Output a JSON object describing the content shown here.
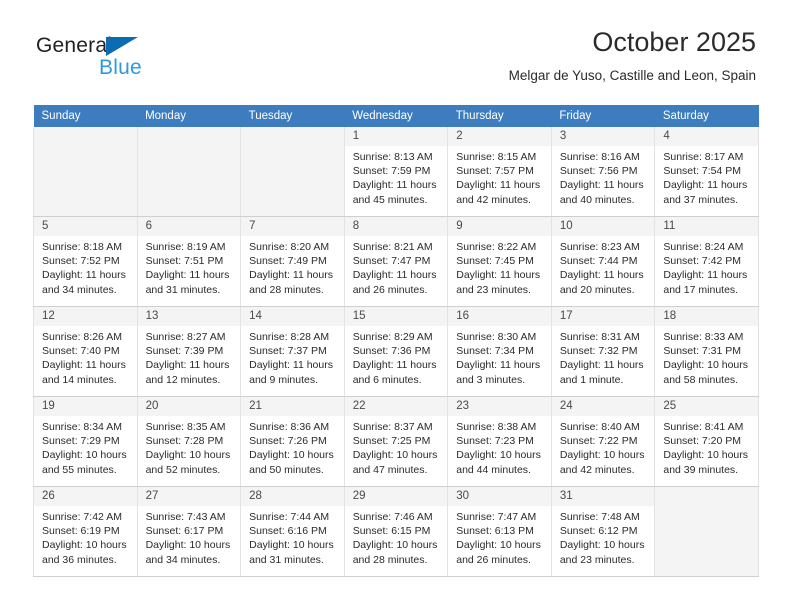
{
  "logo": {
    "word_one": "General",
    "word_two": "Blue",
    "triangle_color": "#0b6cb3",
    "blue_text_color": "#2e9ade"
  },
  "header": {
    "month_title": "October 2025",
    "location": "Melgar de Yuso, Castille and Leon, Spain"
  },
  "theme": {
    "header_row_background": "#3d7dbf",
    "header_row_text": "#ffffff",
    "day_number_background": "#f4f4f4",
    "grid_border": "#cfcfcf",
    "body_text": "#2b2b2b"
  },
  "weekday_headers": [
    "Sunday",
    "Monday",
    "Tuesday",
    "Wednesday",
    "Thursday",
    "Friday",
    "Saturday"
  ],
  "weeks": [
    [
      {
        "day": "",
        "empty": true,
        "sunrise": "",
        "sunset": "",
        "daylight_line1": "",
        "daylight_line2": ""
      },
      {
        "day": "",
        "empty": true,
        "sunrise": "",
        "sunset": "",
        "daylight_line1": "",
        "daylight_line2": ""
      },
      {
        "day": "",
        "empty": true,
        "sunrise": "",
        "sunset": "",
        "daylight_line1": "",
        "daylight_line2": ""
      },
      {
        "day": "1",
        "empty": false,
        "sunrise": "Sunrise: 8:13 AM",
        "sunset": "Sunset: 7:59 PM",
        "daylight_line1": "Daylight: 11 hours",
        "daylight_line2": "and 45 minutes."
      },
      {
        "day": "2",
        "empty": false,
        "sunrise": "Sunrise: 8:15 AM",
        "sunset": "Sunset: 7:57 PM",
        "daylight_line1": "Daylight: 11 hours",
        "daylight_line2": "and 42 minutes."
      },
      {
        "day": "3",
        "empty": false,
        "sunrise": "Sunrise: 8:16 AM",
        "sunset": "Sunset: 7:56 PM",
        "daylight_line1": "Daylight: 11 hours",
        "daylight_line2": "and 40 minutes."
      },
      {
        "day": "4",
        "empty": false,
        "sunrise": "Sunrise: 8:17 AM",
        "sunset": "Sunset: 7:54 PM",
        "daylight_line1": "Daylight: 11 hours",
        "daylight_line2": "and 37 minutes."
      }
    ],
    [
      {
        "day": "5",
        "empty": false,
        "sunrise": "Sunrise: 8:18 AM",
        "sunset": "Sunset: 7:52 PM",
        "daylight_line1": "Daylight: 11 hours",
        "daylight_line2": "and 34 minutes."
      },
      {
        "day": "6",
        "empty": false,
        "sunrise": "Sunrise: 8:19 AM",
        "sunset": "Sunset: 7:51 PM",
        "daylight_line1": "Daylight: 11 hours",
        "daylight_line2": "and 31 minutes."
      },
      {
        "day": "7",
        "empty": false,
        "sunrise": "Sunrise: 8:20 AM",
        "sunset": "Sunset: 7:49 PM",
        "daylight_line1": "Daylight: 11 hours",
        "daylight_line2": "and 28 minutes."
      },
      {
        "day": "8",
        "empty": false,
        "sunrise": "Sunrise: 8:21 AM",
        "sunset": "Sunset: 7:47 PM",
        "daylight_line1": "Daylight: 11 hours",
        "daylight_line2": "and 26 minutes."
      },
      {
        "day": "9",
        "empty": false,
        "sunrise": "Sunrise: 8:22 AM",
        "sunset": "Sunset: 7:45 PM",
        "daylight_line1": "Daylight: 11 hours",
        "daylight_line2": "and 23 minutes."
      },
      {
        "day": "10",
        "empty": false,
        "sunrise": "Sunrise: 8:23 AM",
        "sunset": "Sunset: 7:44 PM",
        "daylight_line1": "Daylight: 11 hours",
        "daylight_line2": "and 20 minutes."
      },
      {
        "day": "11",
        "empty": false,
        "sunrise": "Sunrise: 8:24 AM",
        "sunset": "Sunset: 7:42 PM",
        "daylight_line1": "Daylight: 11 hours",
        "daylight_line2": "and 17 minutes."
      }
    ],
    [
      {
        "day": "12",
        "empty": false,
        "sunrise": "Sunrise: 8:26 AM",
        "sunset": "Sunset: 7:40 PM",
        "daylight_line1": "Daylight: 11 hours",
        "daylight_line2": "and 14 minutes."
      },
      {
        "day": "13",
        "empty": false,
        "sunrise": "Sunrise: 8:27 AM",
        "sunset": "Sunset: 7:39 PM",
        "daylight_line1": "Daylight: 11 hours",
        "daylight_line2": "and 12 minutes."
      },
      {
        "day": "14",
        "empty": false,
        "sunrise": "Sunrise: 8:28 AM",
        "sunset": "Sunset: 7:37 PM",
        "daylight_line1": "Daylight: 11 hours",
        "daylight_line2": "and 9 minutes."
      },
      {
        "day": "15",
        "empty": false,
        "sunrise": "Sunrise: 8:29 AM",
        "sunset": "Sunset: 7:36 PM",
        "daylight_line1": "Daylight: 11 hours",
        "daylight_line2": "and 6 minutes."
      },
      {
        "day": "16",
        "empty": false,
        "sunrise": "Sunrise: 8:30 AM",
        "sunset": "Sunset: 7:34 PM",
        "daylight_line1": "Daylight: 11 hours",
        "daylight_line2": "and 3 minutes."
      },
      {
        "day": "17",
        "empty": false,
        "sunrise": "Sunrise: 8:31 AM",
        "sunset": "Sunset: 7:32 PM",
        "daylight_line1": "Daylight: 11 hours",
        "daylight_line2": "and 1 minute."
      },
      {
        "day": "18",
        "empty": false,
        "sunrise": "Sunrise: 8:33 AM",
        "sunset": "Sunset: 7:31 PM",
        "daylight_line1": "Daylight: 10 hours",
        "daylight_line2": "and 58 minutes."
      }
    ],
    [
      {
        "day": "19",
        "empty": false,
        "sunrise": "Sunrise: 8:34 AM",
        "sunset": "Sunset: 7:29 PM",
        "daylight_line1": "Daylight: 10 hours",
        "daylight_line2": "and 55 minutes."
      },
      {
        "day": "20",
        "empty": false,
        "sunrise": "Sunrise: 8:35 AM",
        "sunset": "Sunset: 7:28 PM",
        "daylight_line1": "Daylight: 10 hours",
        "daylight_line2": "and 52 minutes."
      },
      {
        "day": "21",
        "empty": false,
        "sunrise": "Sunrise: 8:36 AM",
        "sunset": "Sunset: 7:26 PM",
        "daylight_line1": "Daylight: 10 hours",
        "daylight_line2": "and 50 minutes."
      },
      {
        "day": "22",
        "empty": false,
        "sunrise": "Sunrise: 8:37 AM",
        "sunset": "Sunset: 7:25 PM",
        "daylight_line1": "Daylight: 10 hours",
        "daylight_line2": "and 47 minutes."
      },
      {
        "day": "23",
        "empty": false,
        "sunrise": "Sunrise: 8:38 AM",
        "sunset": "Sunset: 7:23 PM",
        "daylight_line1": "Daylight: 10 hours",
        "daylight_line2": "and 44 minutes."
      },
      {
        "day": "24",
        "empty": false,
        "sunrise": "Sunrise: 8:40 AM",
        "sunset": "Sunset: 7:22 PM",
        "daylight_line1": "Daylight: 10 hours",
        "daylight_line2": "and 42 minutes."
      },
      {
        "day": "25",
        "empty": false,
        "sunrise": "Sunrise: 8:41 AM",
        "sunset": "Sunset: 7:20 PM",
        "daylight_line1": "Daylight: 10 hours",
        "daylight_line2": "and 39 minutes."
      }
    ],
    [
      {
        "day": "26",
        "empty": false,
        "sunrise": "Sunrise: 7:42 AM",
        "sunset": "Sunset: 6:19 PM",
        "daylight_line1": "Daylight: 10 hours",
        "daylight_line2": "and 36 minutes."
      },
      {
        "day": "27",
        "empty": false,
        "sunrise": "Sunrise: 7:43 AM",
        "sunset": "Sunset: 6:17 PM",
        "daylight_line1": "Daylight: 10 hours",
        "daylight_line2": "and 34 minutes."
      },
      {
        "day": "28",
        "empty": false,
        "sunrise": "Sunrise: 7:44 AM",
        "sunset": "Sunset: 6:16 PM",
        "daylight_line1": "Daylight: 10 hours",
        "daylight_line2": "and 31 minutes."
      },
      {
        "day": "29",
        "empty": false,
        "sunrise": "Sunrise: 7:46 AM",
        "sunset": "Sunset: 6:15 PM",
        "daylight_line1": "Daylight: 10 hours",
        "daylight_line2": "and 28 minutes."
      },
      {
        "day": "30",
        "empty": false,
        "sunrise": "Sunrise: 7:47 AM",
        "sunset": "Sunset: 6:13 PM",
        "daylight_line1": "Daylight: 10 hours",
        "daylight_line2": "and 26 minutes."
      },
      {
        "day": "31",
        "empty": false,
        "sunrise": "Sunrise: 7:48 AM",
        "sunset": "Sunset: 6:12 PM",
        "daylight_line1": "Daylight: 10 hours",
        "daylight_line2": "and 23 minutes."
      },
      {
        "day": "",
        "empty": true,
        "sunrise": "",
        "sunset": "",
        "daylight_line1": "",
        "daylight_line2": ""
      }
    ]
  ]
}
